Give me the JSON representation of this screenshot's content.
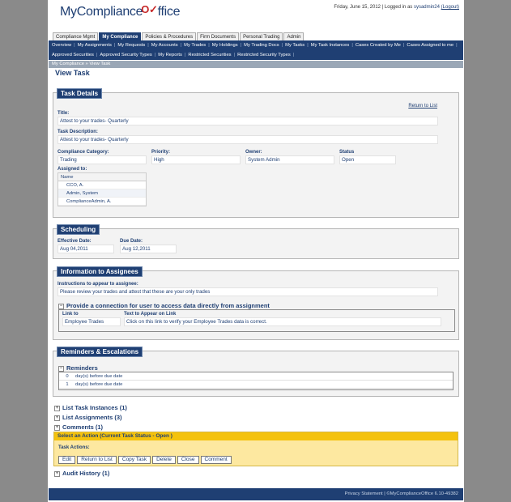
{
  "header": {
    "logo_text": "MyCompliance",
    "logo_suffix": "ffice",
    "date": "Friday, June 15, 2012",
    "logged_in_as": "| Logged in as",
    "username": "sysadmin24",
    "logout": "(Logout)"
  },
  "main_tabs": [
    "Compliance Mgmt",
    "My Compliance",
    "Policies & Procedures",
    "Firm Documents",
    "Personal Trading",
    "Admin"
  ],
  "subnav": {
    "row1": [
      "Overview",
      "My Assignments",
      "My Requests",
      "My Accounts",
      "My Trades",
      "My Holdings",
      "My Trading Docs",
      "My Tasks",
      "My Task Instances",
      "Cases Created by Me",
      "Cases Assigned to me"
    ],
    "row2": [
      "Approved Securities",
      "Approved Security Types",
      "My Reports",
      "Restricted Securities",
      "Restricted Security Types"
    ]
  },
  "breadcrumb": "My Compliance »  View Task",
  "page_title": "View Task",
  "task_details": {
    "header": "Task Details",
    "return_link": "Return to List",
    "title_label": "Title:",
    "title_value": "Attest to your trades- Quarterly",
    "desc_label": "Task Description:",
    "desc_value": "Attest to your trades- Quarterly",
    "category_label": "Compliance Category:",
    "category_value": "Trading",
    "priority_label": "Priority:",
    "priority_value": "High",
    "owner_label": "Owner:",
    "owner_value": "System Admin",
    "status_label": "Status",
    "status_value": "Open",
    "assigned_label": "Assigned to:",
    "assigned_header": "Name",
    "assigned": [
      "CCO, A.",
      "Admin, System",
      "ComplianceAdmin, A."
    ]
  },
  "scheduling": {
    "header": "Scheduling",
    "effective_label": "Effective Date:",
    "effective_value": "Aug 04,2011",
    "due_label": "Due Date:",
    "due_value": "Aug 12,2011"
  },
  "info": {
    "header": "Information to Assignees",
    "instructions_label": "Instructions to appear to assignee:",
    "instructions_value": "Please review your trades and attest that these are your only trades",
    "connection_heading": "Provide a connection for user to access data directly from assignment",
    "link_to_label": "Link to",
    "link_to_value": "Employee Trades",
    "link_text_label": "Text to Appear on Link",
    "link_text_value": "Click on this link to verify your Employee Trades data is correct."
  },
  "reminders": {
    "header": "Reminders & Escalations",
    "sub_heading": "Reminders",
    "rows": [
      {
        "num": "0",
        "text": "day(s) before due date"
      },
      {
        "num": "1",
        "text": "day(s) before due date"
      }
    ]
  },
  "collapsibles": {
    "task_instances": "List Task Instances (1)",
    "assignments": "List Assignments (3)",
    "comments": "Comments (1)",
    "audit": "Audit History (1)"
  },
  "actions": {
    "header": "Select an Action (Current Task Status - Open )",
    "label": "Task Actions:",
    "buttons": [
      "Edit",
      "Return to List",
      "Copy Task",
      "Delete",
      "Close",
      "Comment"
    ]
  },
  "footer": {
    "privacy": "Privacy Statement",
    "copyright": "|  ©MyComplianceOffice 6.10-49382"
  },
  "colors": {
    "brand_navy": "#1f3f73",
    "action_yellow": "#f4c20d",
    "action_bg": "#fde8a0"
  }
}
